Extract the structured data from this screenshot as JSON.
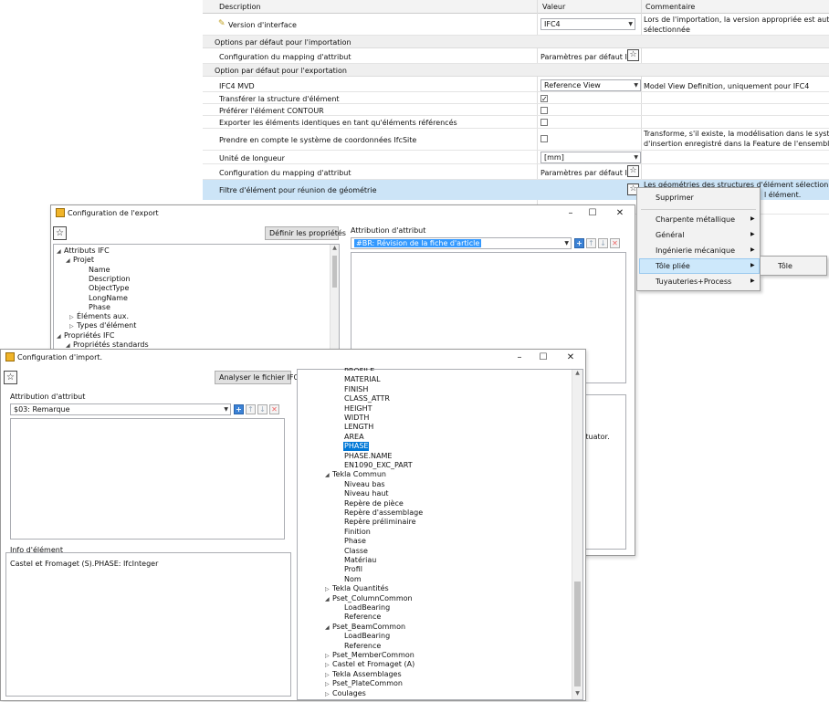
{
  "bg": {
    "headers": [
      "Description",
      "Valeur",
      "Commentaire"
    ],
    "rows": {
      "version": {
        "label": "Version d'interface",
        "value": "IFC4",
        "comment1": "Lors de l'importation, la version appropriée est automatiqu",
        "comment2": "sélectionnée"
      },
      "import_section": "Options par défaut pour l'importation",
      "import_mapping": {
        "label": "Configuration du mapping d'attribut",
        "value": "Paramètres par défaut ISD"
      },
      "export_section": "Option par défaut pour l'exportation",
      "mvd": {
        "label": "IFC4 MVD",
        "value": "Reference View",
        "comment": "Model View Definition, uniquement pour IFC4"
      },
      "transfer": {
        "label": "Transférer la structure d'élément"
      },
      "contour": {
        "label": "Préférer l'élément CONTOUR"
      },
      "identical": {
        "label": "Exporter les éléments identiques en tant qu'éléments référencés"
      },
      "ifcsite": {
        "label": "Prendre en compte le système de coordonnées IfcSite",
        "comment1": "Transforme, s'il existe, la modélisation dans le système de c",
        "comment2": "d'insertion enregistré dans la Feature de l'ensemble IfcSite"
      },
      "unit": {
        "label": "Unité de longueur",
        "value": "[mm]"
      },
      "export_mapping": {
        "label": "Configuration du mapping d'attribut",
        "value": "Paramètres par défaut ISD"
      },
      "filter": {
        "label": "Filtre d'élément pour réunion de géométrie",
        "comment1": "Les géométries des structures d'élément sélectionnées par",
        "comment2": "l élément."
      }
    }
  },
  "menu": {
    "items": [
      "Supprimer",
      "Charpente métallique",
      "Général",
      "Ingénierie mécanique",
      "Tôle pliée",
      "Tuyauteries+Process"
    ],
    "submenu": "Tôle"
  },
  "export": {
    "title": "Configuration de l'export",
    "define_btn": "Définir les propriétés",
    "attr_label": "Attribution d'attribut",
    "combo": "#BR: Révision de la fiche d'article",
    "partial": "ctuator.",
    "tree": [
      "Attributs IFC",
      "Projet",
      "Name",
      "Description",
      "ObjectType",
      "LongName",
      "Phase",
      "Éléments aux.",
      "Types d'élément",
      "Propriétés IFC",
      "Propriétés standards"
    ]
  },
  "import": {
    "title": "Configuration d'import.",
    "analyze_btn": "Analyser le fichier IFC",
    "attr_label": "Attribution d'attribut",
    "combo": "$03: Remarque",
    "info_label": "Info d'élément",
    "info_text": "Castel et Fromaget (S).PHASE: IfcInteger",
    "tree": [
      "PROFILE",
      "MATERIAL",
      "FINISH",
      "CLASS_ATTR",
      "HEIGHT",
      "WIDTH",
      "LENGTH",
      "AREA",
      "PHASE",
      "PHASE.NAME",
      "EN1090_EXC_PART",
      "Tekla Commun",
      "Niveau bas",
      "Niveau haut",
      "Repère de pièce",
      "Repère d'assemblage",
      "Repère préliminaire",
      "Finition",
      "Phase",
      "Classe",
      "Matériau",
      "Profil",
      "Nom",
      "Tekla Quantités",
      "Pset_ColumnCommon",
      "LoadBearing",
      "Reference",
      "Pset_BeamCommon",
      "LoadBearing",
      "Reference",
      "Pset_MemberCommon",
      "Castel et Fromaget (A)",
      "Tekla Assemblages",
      "Pset_PlateCommon",
      "Coulages"
    ]
  }
}
